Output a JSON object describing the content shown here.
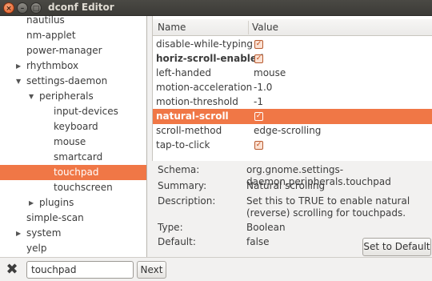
{
  "window": {
    "title": "dconf Editor",
    "buttons": {
      "close": "×",
      "minimize": "–",
      "maximize": "□"
    }
  },
  "tree": {
    "items": [
      {
        "label": "nautilus",
        "level": 1,
        "expander": "none"
      },
      {
        "label": "nm-applet",
        "level": 1,
        "expander": "none"
      },
      {
        "label": "power-manager",
        "level": 1,
        "expander": "none"
      },
      {
        "label": "rhythmbox",
        "level": 1,
        "expander": "collapsed"
      },
      {
        "label": "settings-daemon",
        "level": 1,
        "expander": "expanded"
      },
      {
        "label": "peripherals",
        "level": 2,
        "expander": "expanded"
      },
      {
        "label": "input-devices",
        "level": 3,
        "expander": "none"
      },
      {
        "label": "keyboard",
        "level": 3,
        "expander": "none"
      },
      {
        "label": "mouse",
        "level": 3,
        "expander": "none"
      },
      {
        "label": "smartcard",
        "level": 3,
        "expander": "none"
      },
      {
        "label": "touchpad",
        "level": 3,
        "expander": "none",
        "selected": true
      },
      {
        "label": "touchscreen",
        "level": 3,
        "expander": "none"
      },
      {
        "label": "plugins",
        "level": 2,
        "expander": "collapsed"
      },
      {
        "label": "simple-scan",
        "level": 1,
        "expander": "none"
      },
      {
        "label": "system",
        "level": 1,
        "expander": "collapsed"
      },
      {
        "label": "yelp",
        "level": 1,
        "expander": "none"
      }
    ]
  },
  "keys": {
    "header": {
      "name": "Name",
      "value": "Value"
    },
    "rows": [
      {
        "name": "disable-while-typing",
        "value": true,
        "type": "bool"
      },
      {
        "name": "horiz-scroll-enabled",
        "value": true,
        "type": "bool",
        "bold": true
      },
      {
        "name": "left-handed",
        "value": "mouse",
        "type": "text"
      },
      {
        "name": "motion-acceleration",
        "value": "-1.0",
        "type": "text"
      },
      {
        "name": "motion-threshold",
        "value": "-1",
        "type": "text"
      },
      {
        "name": "natural-scroll",
        "value": true,
        "type": "bool",
        "bold": true,
        "selected": true
      },
      {
        "name": "scroll-method",
        "value": "edge-scrolling",
        "type": "text"
      },
      {
        "name": "tap-to-click",
        "value": true,
        "type": "bool"
      }
    ]
  },
  "details": {
    "schema_label": "Schema:",
    "schema_value": "org.gnome.settings-daemon.peripherals.touchpad",
    "summary_label": "Summary:",
    "summary_value": "Natural scrolling",
    "description_label": "Description:",
    "description_value": "Set this to TRUE to enable natural (reverse) scrolling for touchpads.",
    "type_label": "Type:",
    "type_value": "Boolean",
    "default_label": "Default:",
    "default_value": "false",
    "set_default_label": "Set to Default"
  },
  "search": {
    "clear_icon": "close-icon",
    "value": "touchpad",
    "next_label": "Next"
  },
  "colors": {
    "selection": "#f07746",
    "titlebar": "#3c3b37",
    "window_bg": "#f2f1f0"
  }
}
